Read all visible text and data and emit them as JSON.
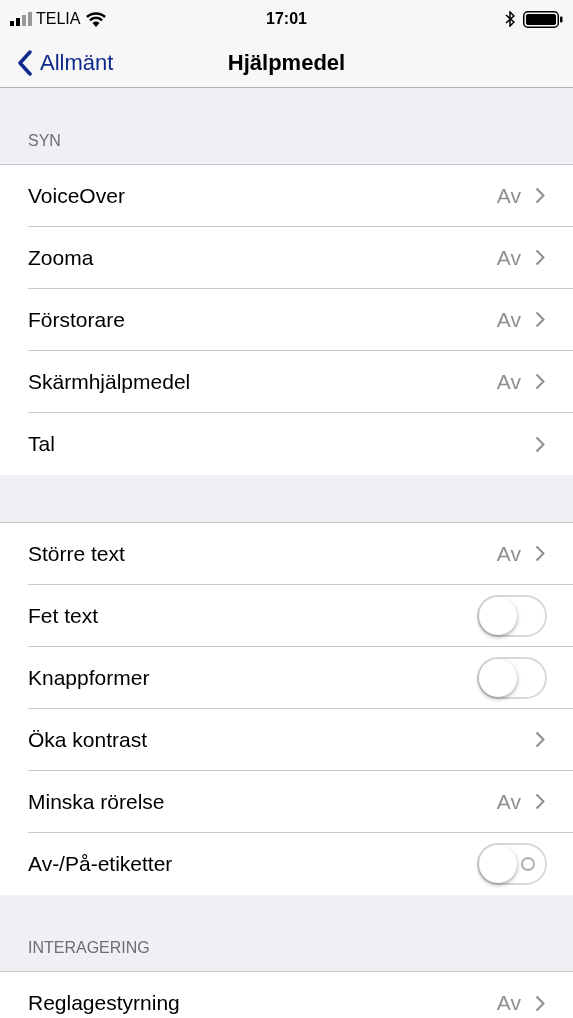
{
  "status_bar": {
    "carrier": "TELIA",
    "time": "17:01"
  },
  "nav": {
    "back": "Allmänt",
    "title": "Hjälpmedel"
  },
  "sections": [
    {
      "header": "SYN",
      "rows": [
        {
          "kind": "link",
          "label": "VoiceOver",
          "value": "Av"
        },
        {
          "kind": "link",
          "label": "Zooma",
          "value": "Av"
        },
        {
          "kind": "link",
          "label": "Förstorare",
          "value": "Av"
        },
        {
          "kind": "link",
          "label": "Skärmhjälpmedel",
          "value": "Av"
        },
        {
          "kind": "link",
          "label": "Tal"
        }
      ]
    },
    {
      "rows": [
        {
          "kind": "link",
          "label": "Större text",
          "value": "Av"
        },
        {
          "kind": "toggle",
          "label": "Fet text",
          "on": false,
          "off_label": false
        },
        {
          "kind": "toggle",
          "label": "Knappformer",
          "on": false,
          "off_label": false
        },
        {
          "kind": "link",
          "label": "Öka kontrast"
        },
        {
          "kind": "link",
          "label": "Minska rörelse",
          "value": "Av"
        },
        {
          "kind": "toggle",
          "label": "Av-/På-etiketter",
          "on": false,
          "off_label": true
        }
      ]
    },
    {
      "header": "INTERAGERING",
      "rows": [
        {
          "kind": "link",
          "label": "Reglagestyrning",
          "value": "Av"
        }
      ]
    }
  ]
}
